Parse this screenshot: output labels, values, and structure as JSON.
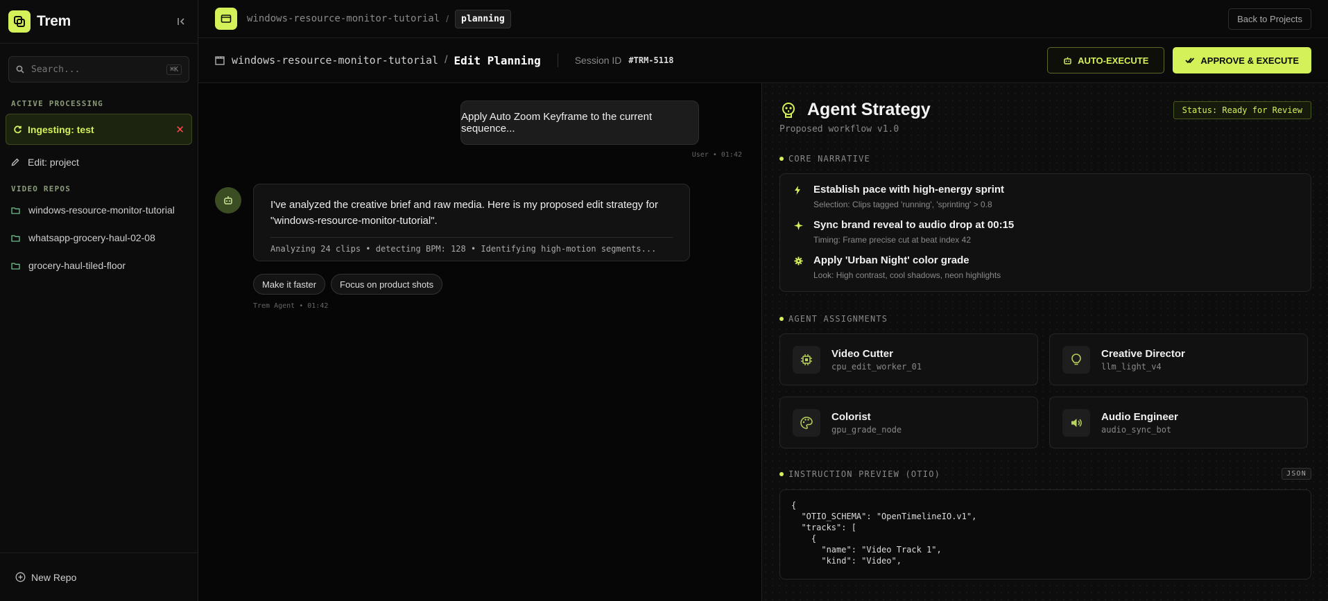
{
  "sidebar": {
    "brand": "Trem",
    "search_placeholder": "Search...",
    "search_shortcut": "⌘K",
    "active_processing_label": "ACTIVE PROCESSING",
    "active_item": "Ingesting: test",
    "edit_item": "Edit: project",
    "video_repos_label": "VIDEO REPOS",
    "repos": [
      "windows-resource-monitor-tutorial",
      "whatsapp-grocery-haul-02-08",
      "grocery-haul-tiled-floor"
    ],
    "new_repo": "New Repo"
  },
  "topbar": {
    "crumb_repo": "windows-resource-monitor-tutorial",
    "crumb_sep": "/",
    "crumb_current": "planning",
    "back_button": "Back to Projects"
  },
  "subbar": {
    "repo": "windows-resource-monitor-tutorial",
    "sep": "/",
    "title": "Edit Planning",
    "session_label": "Session ID",
    "session_id": "#TRM-5118",
    "auto_execute": "AUTO-EXECUTE",
    "approve_execute": "APPROVE & EXECUTE"
  },
  "chat": {
    "user_message": "Apply Auto Zoom Keyframe to the current sequence...",
    "user_meta": "User • 01:42",
    "bot_message": "I've analyzed the creative brief and raw media. Here is my proposed edit strategy for \"windows-resource-monitor-tutorial\".",
    "bot_analysis": "Analyzing 24 clips • detecting BPM: 128 • Identifying high-motion segments...",
    "chips": [
      "Make it faster",
      "Focus on product shots"
    ],
    "bot_meta": "Trem Agent • 01:42"
  },
  "strategy": {
    "title": "Agent Strategy",
    "status": "Status: Ready for Review",
    "subtitle": "Proposed workflow v1.0",
    "core_narrative_label": "CORE NARRATIVE",
    "narrative": [
      {
        "title": "Establish pace with high-energy sprint",
        "desc": "Selection: Clips tagged 'running', 'sprinting' > 0.8",
        "icon": "bolt-icon"
      },
      {
        "title": "Sync brand reveal to audio drop at 00:15",
        "desc": "Timing: Frame precise cut at beat index 42",
        "icon": "sparkle-icon"
      },
      {
        "title": "Apply 'Urban Night' color grade",
        "desc": "Look: High contrast, cool shadows, neon highlights",
        "icon": "gear-icon"
      }
    ],
    "agent_assignments_label": "AGENT ASSIGNMENTS",
    "agents": [
      {
        "name": "Video Cutter",
        "id": "cpu_edit_worker_01",
        "icon": "chip-icon"
      },
      {
        "name": "Creative Director",
        "id": "llm_light_v4",
        "icon": "lightbulb-icon"
      },
      {
        "name": "Colorist",
        "id": "gpu_grade_node",
        "icon": "palette-icon"
      },
      {
        "name": "Audio Engineer",
        "id": "audio_sync_bot",
        "icon": "speaker-icon"
      }
    ],
    "instruction_label": "INSTRUCTION PREVIEW (OTIO)",
    "json_tag": "JSON",
    "code": "{\n  \"OTIO_SCHEMA\": \"OpenTimelineIO.v1\",\n  \"tracks\": [\n    {\n      \"name\": \"Video Track 1\",\n      \"kind\": \"Video\","
  },
  "colors": {
    "accent": "#d4f15a",
    "danger": "#ff4d4d",
    "background": "#0a0a0a"
  }
}
